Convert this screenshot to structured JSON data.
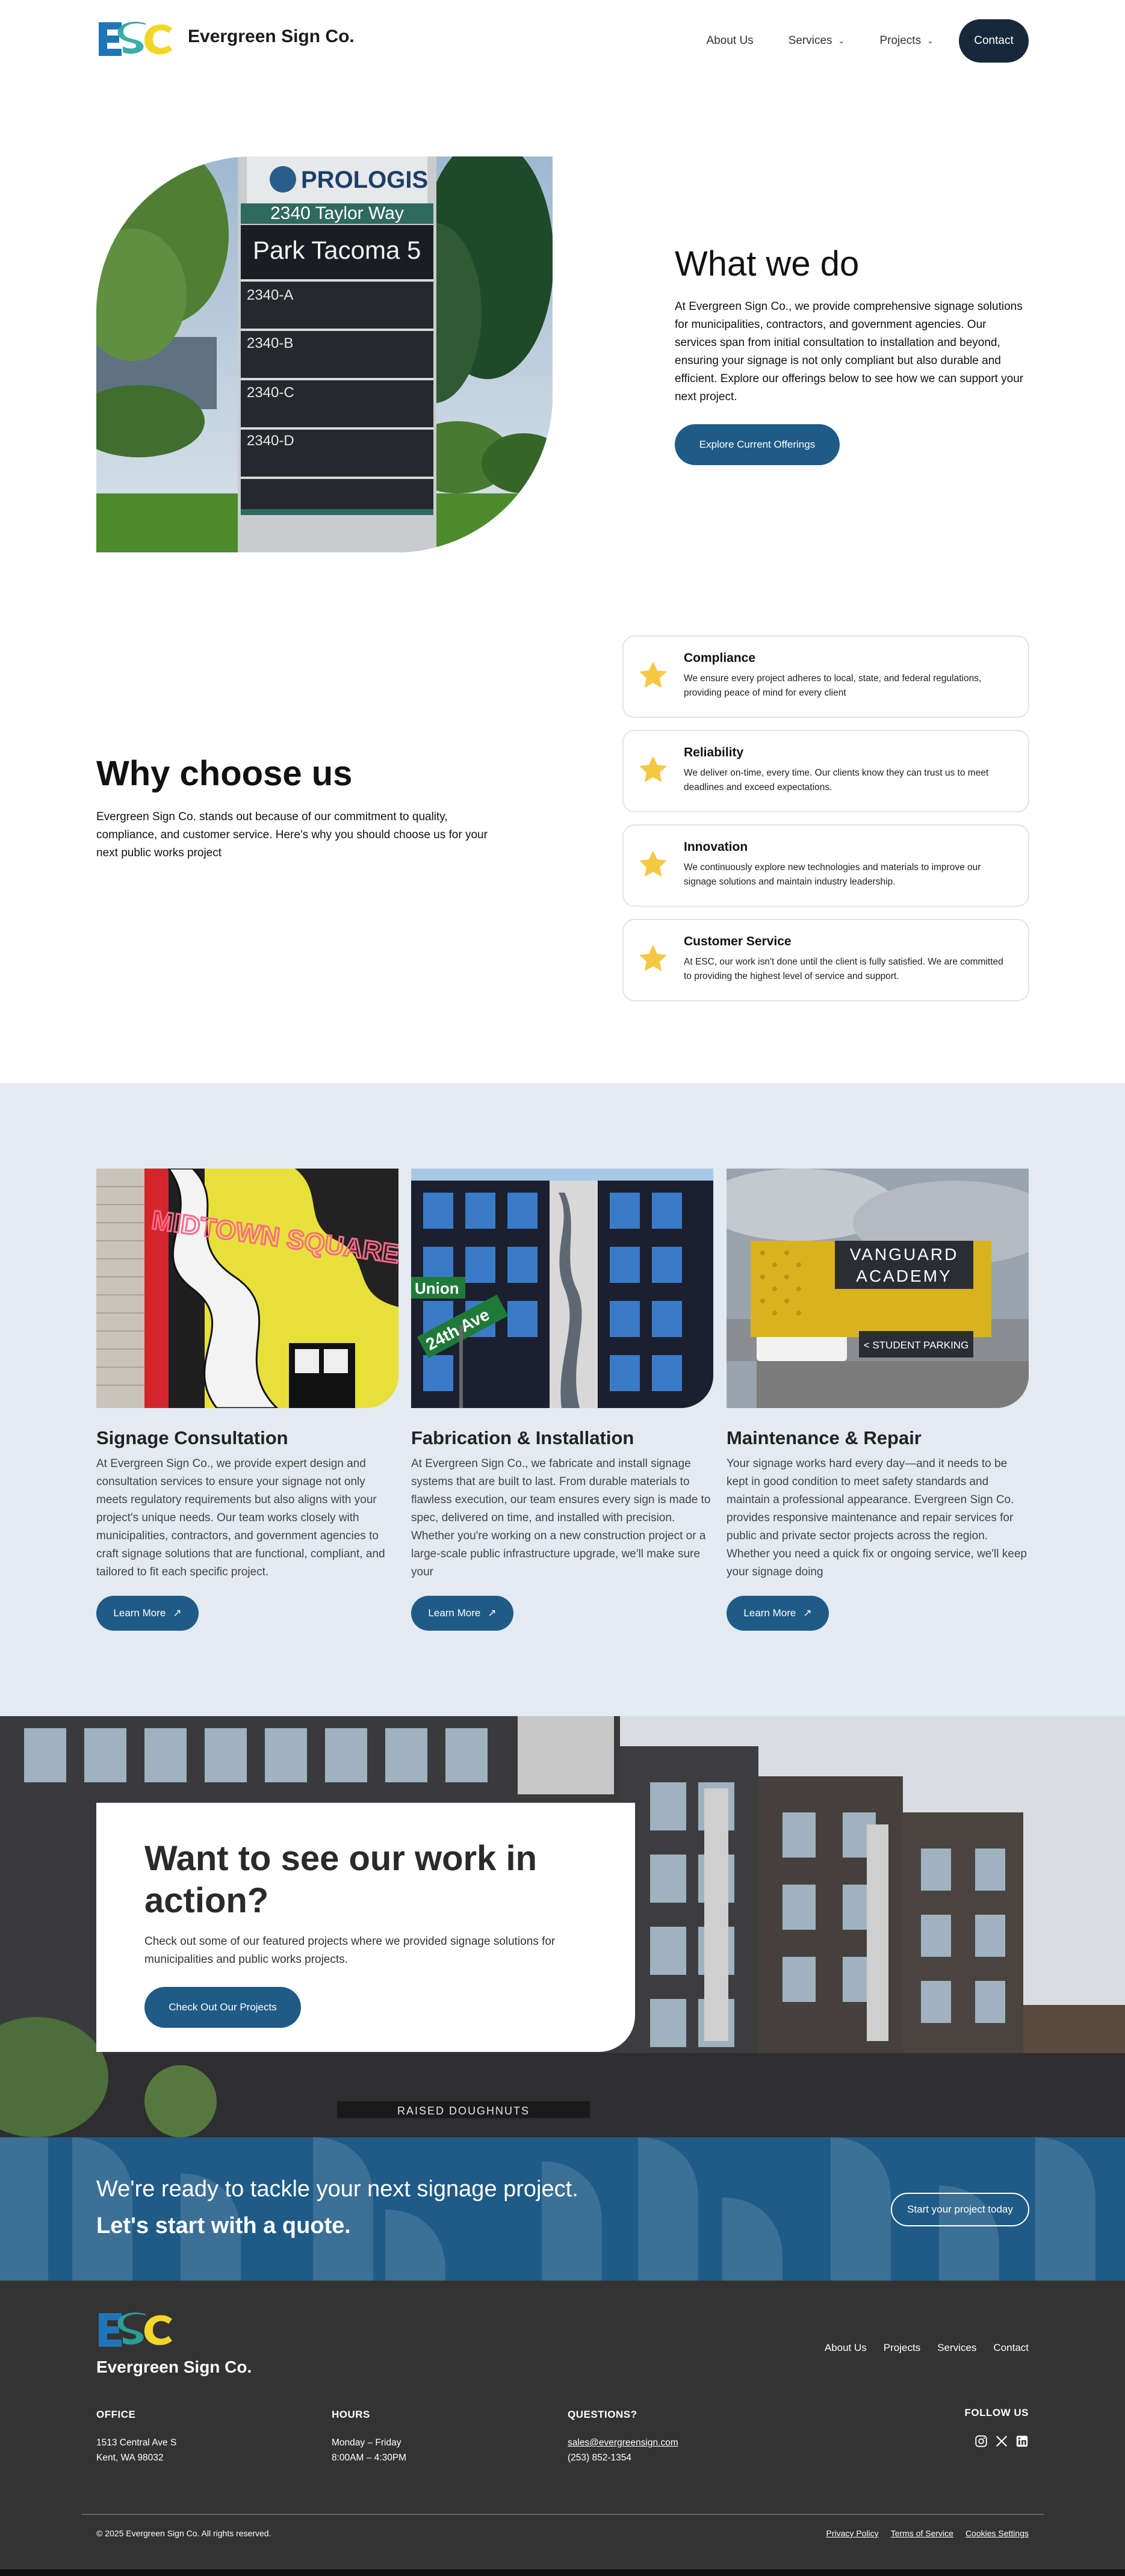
{
  "brand": {
    "name": "Evergreen Sign Co.",
    "logo_text": "ESC"
  },
  "nav": {
    "items": [
      {
        "label": "About Us",
        "dropdown": false
      },
      {
        "label": "Services",
        "dropdown": true
      },
      {
        "label": "Projects",
        "dropdown": true
      }
    ],
    "contact_label": "Contact"
  },
  "hero_sign": {
    "brand": "PROLOGIS",
    "address": "2340 Taylor Way",
    "park": "Park Tacoma 5",
    "units": [
      "2340-A",
      "2340-B",
      "2340-C",
      "2340-D"
    ]
  },
  "what": {
    "title": "What we do",
    "body": "At Evergreen Sign Co., we provide comprehensive signage solutions for municipalities, contractors, and government agencies. Our services span from initial consultation to installation and beyond, ensuring your signage is not only compliant but also durable and efficient. Explore our offerings below to see how we can support your next project.",
    "button": "Explore Current Offerings"
  },
  "why": {
    "title": "Why choose us",
    "body": "Evergreen Sign Co. stands out because of our commitment to quality, compliance, and customer service. Here's why you should choose us for your next public works project",
    "features": [
      {
        "title": "Compliance",
        "text": "We ensure every project adheres to local, state, and federal regulations, providing peace of mind for every client"
      },
      {
        "title": "Reliability",
        "text": "We deliver on-time, every time. Our clients know they can trust us to meet deadlines and exceed expectations."
      },
      {
        "title": "Innovation",
        "text": "We continuously explore new technologies and materials to improve our signage solutions and maintain industry leadership."
      },
      {
        "title": "Customer Service",
        "text": "At ESC, our work isn't done until the client is fully satisfied. We are committed to providing the highest level of service and support."
      }
    ]
  },
  "services": [
    {
      "title": "Signage Consultation",
      "text": "At Evergreen Sign Co., we provide expert design and consultation services to ensure your signage not only meets regulatory requirements but also aligns with your project's unique needs. Our team works closely with municipalities, contractors, and government agencies to craft signage solutions that are functional, compliant, and tailored to fit each specific project.",
      "button": "Learn More"
    },
    {
      "title": "Fabrication & Installation",
      "text": "At Evergreen Sign Co., we fabricate and install signage systems that are built to last. From durable materials to flawless execution, our team ensures every sign is made to spec, delivered on time, and installed with precision. Whether you're working on a new construction project or a large-scale public infrastructure upgrade, we'll make sure your",
      "button": "Learn More"
    },
    {
      "title": "Maintenance & Repair",
      "text": "Your signage works hard every day—and it needs to be kept in good condition to meet safety standards and maintain a professional appearance. Evergreen Sign Co. provides responsive maintenance and repair services for public and private sector projects across the region. Whether you need a quick fix or ongoing service, we'll keep your signage doing",
      "button": "Learn More"
    }
  ],
  "service_images": {
    "mural_text": "MIDTOWN SQUARE",
    "street_sign_1": "Union",
    "street_sign_2": "24th Ave",
    "academy_line1": "VANGUARD",
    "academy_line2": "ACADEMY",
    "academy_sub": "< STUDENT PARKING"
  },
  "action": {
    "title": "Want to see our work in action?",
    "body": "Check out some of our featured projects where we provided signage solutions for municipalities and public works projects.",
    "button": "Check Out Our Projects",
    "storefront_text": "RAISED DOUGHNUTS"
  },
  "quote": {
    "line1": "We're ready to tackle your next signage project.",
    "line2": "Let's start with a quote.",
    "button": "Start your project today"
  },
  "footer": {
    "links": [
      "About Us",
      "Projects",
      "Services",
      "Contact"
    ],
    "office": {
      "heading": "OFFICE",
      "line1": "1513 Central Ave S",
      "line2": "Kent, WA 98032"
    },
    "hours": {
      "heading": "HOURS",
      "line1": "Monday – Friday",
      "line2": "8:00AM – 4:30PM"
    },
    "questions": {
      "heading": "QUESTIONS?",
      "email": "sales@evergreensign.com",
      "phone": "(253) 852-1354"
    },
    "follow": {
      "heading": "FOLLOW US",
      "icons": [
        "instagram-icon",
        "x-icon",
        "linkedin-icon"
      ]
    },
    "copyright": "© 2025 Evergreen Sign Co. All rights reserved.",
    "legal": [
      "Privacy Policy",
      "Terms of Service",
      "Cookies Settings"
    ]
  },
  "colors": {
    "navy": "#17283a",
    "blue": "#1f5b87",
    "light_band": "#e3eaf1",
    "footer": "#333333",
    "star": "#f5c842"
  }
}
